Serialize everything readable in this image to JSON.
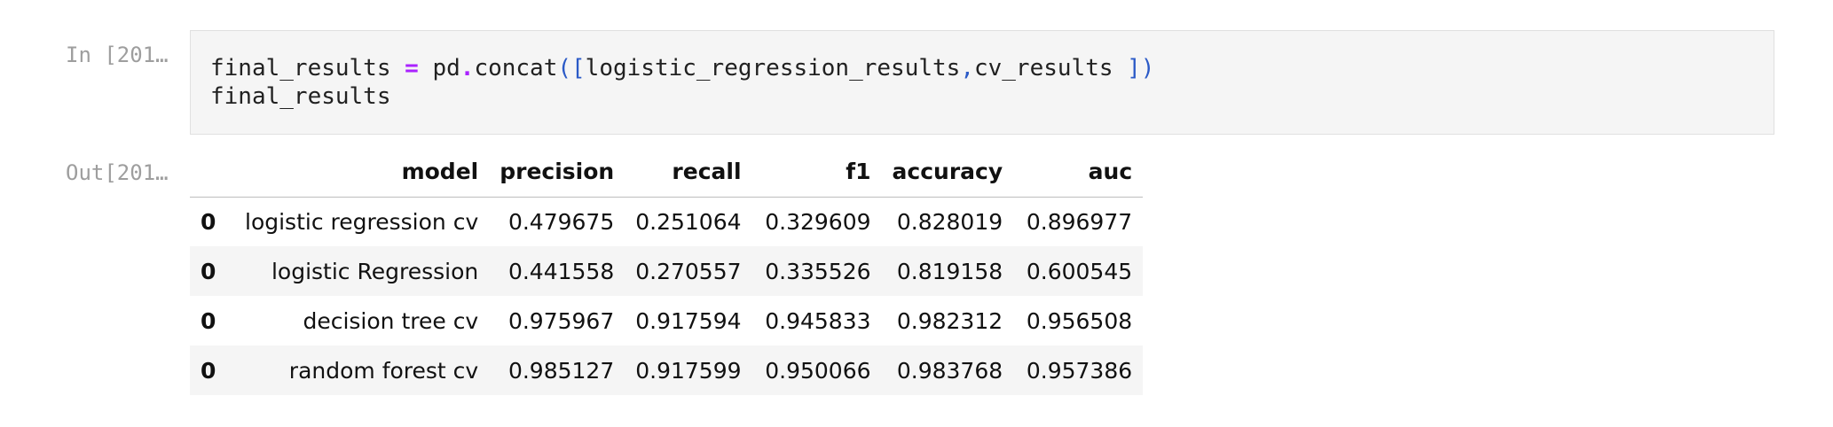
{
  "cell": {
    "in_prompt": "In [201…",
    "out_prompt": "Out[201…",
    "code": {
      "line1": {
        "t1": "final_results ",
        "t2": "=",
        "t3": " pd",
        "t4": ".",
        "t5": "concat",
        "t6": "([",
        "t7": "logistic_regression_results",
        "t8": ",",
        "t9": "cv_results ",
        "t10": "])"
      },
      "line2": "final_results"
    }
  },
  "table": {
    "columns": [
      "model",
      "precision",
      "recall",
      "f1",
      "accuracy",
      "auc"
    ],
    "rows": [
      {
        "index": "0",
        "model": "logistic regression cv",
        "precision": "0.479675",
        "recall": "0.251064",
        "f1": "0.329609",
        "accuracy": "0.828019",
        "auc": "0.896977"
      },
      {
        "index": "0",
        "model": "logistic Regression",
        "precision": "0.441558",
        "recall": "0.270557",
        "f1": "0.335526",
        "accuracy": "0.819158",
        "auc": "0.600545"
      },
      {
        "index": "0",
        "model": "decision tree cv",
        "precision": "0.975967",
        "recall": "0.917594",
        "f1": "0.945833",
        "accuracy": "0.982312",
        "auc": "0.956508"
      },
      {
        "index": "0",
        "model": "random forest cv",
        "precision": "0.985127",
        "recall": "0.917599",
        "f1": "0.950066",
        "accuracy": "0.983768",
        "auc": "0.957386"
      }
    ]
  },
  "colors": {
    "operator": "#aa22ff",
    "bracket": "#2b5ac7",
    "prompt": "#9e9e9e",
    "cell_bg": "#f5f5f5"
  }
}
